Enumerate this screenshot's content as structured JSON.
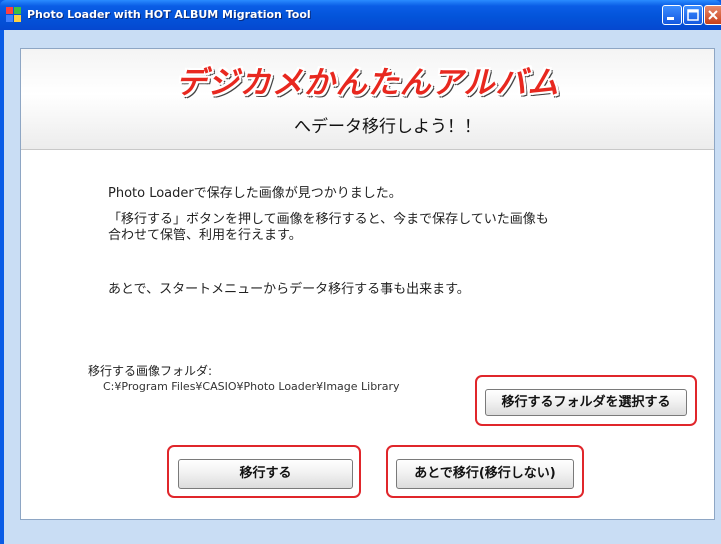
{
  "window": {
    "title": "Photo Loader with HOT ALBUM Migration Tool"
  },
  "header": {
    "logo_text": "デジカメかんたんアルバム",
    "subtitle": "へデータ移行しよう！！"
  },
  "body": {
    "message_1": "Photo Loaderで保存した画像が見つかりました。",
    "message_2": "「移行する」ボタンを押して画像を移行すると、今まで保存していた画像も",
    "message_3": "合わせて保管、利用を行えます。",
    "message_4": "あとで、スタートメニューからデータ移行する事も出来ます。"
  },
  "folder": {
    "label": "移行する画像フォルダ:",
    "path": "C:¥Program Files¥CASIO¥Photo Loader¥Image Library",
    "select_button": "移行するフォルダを選択する"
  },
  "actions": {
    "migrate_button": "移行する",
    "later_button": "あとで移行(移行しない)"
  },
  "colors": {
    "titlebar": "#0a5ce6",
    "logo_red": "#e8281f",
    "highlight": "#e0262b",
    "client_bg": "#c9ddf4"
  }
}
